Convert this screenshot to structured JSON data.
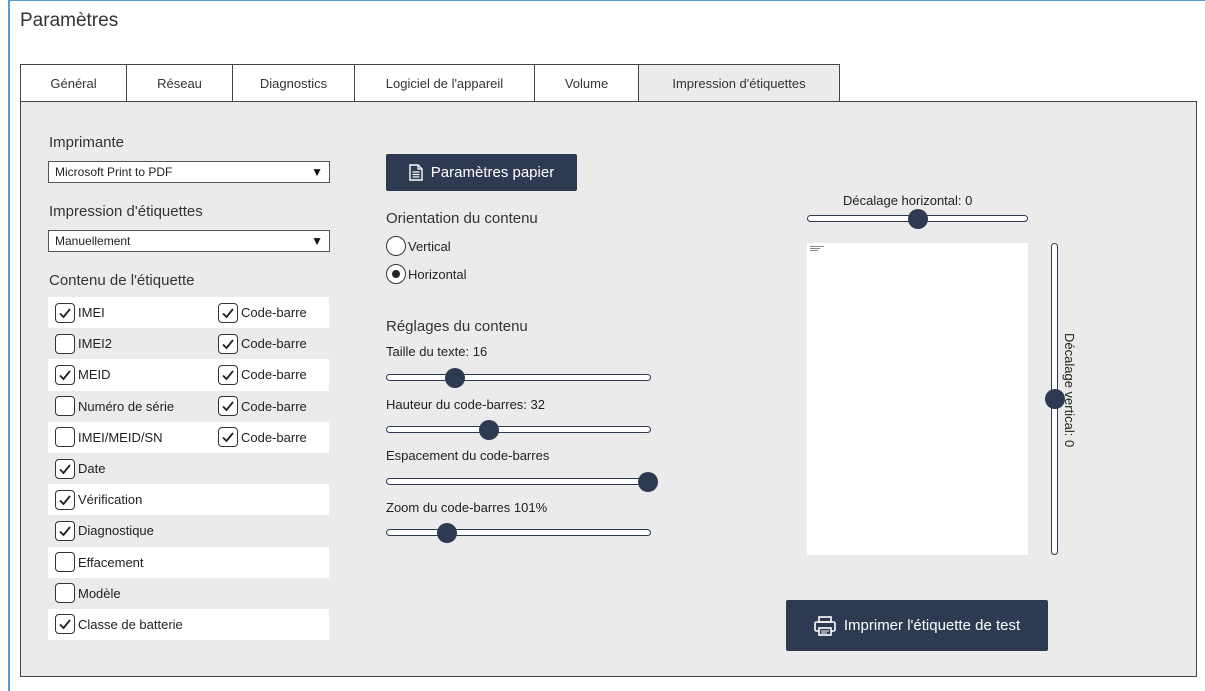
{
  "page_title": "Paramètres",
  "tabs": [
    {
      "label": "Général"
    },
    {
      "label": "Réseau"
    },
    {
      "label": "Diagnostics"
    },
    {
      "label": "Logiciel de l'appareil"
    },
    {
      "label": "Volume"
    },
    {
      "label": "Impression d'étiquettes",
      "active": true
    }
  ],
  "printer": {
    "label": "Imprimante",
    "selected": "Microsoft Print to PDF"
  },
  "label_printing": {
    "label": "Impression d'étiquettes",
    "selected": "Manuellement"
  },
  "label_content": {
    "label": "Contenu de l'étiquette",
    "items": [
      {
        "label": "IMEI",
        "checked": true,
        "barcode_label": "Code-barre",
        "barcode_checked": true
      },
      {
        "label": "IMEI2",
        "checked": false,
        "barcode_label": "Code-barre",
        "barcode_checked": true
      },
      {
        "label": "MEID",
        "checked": true,
        "barcode_label": "Code-barre",
        "barcode_checked": true
      },
      {
        "label": "Numéro de série",
        "checked": false,
        "barcode_label": "Code-barre",
        "barcode_checked": true
      },
      {
        "label": "IMEI/MEID/SN",
        "checked": false,
        "barcode_label": "Code-barre",
        "barcode_checked": true
      },
      {
        "label": "Date",
        "checked": true
      },
      {
        "label": "Vérification",
        "checked": true
      },
      {
        "label": "Diagnostique",
        "checked": true
      },
      {
        "label": "Effacement",
        "checked": false
      },
      {
        "label": "Modèle",
        "checked": false
      },
      {
        "label": "Classe de batterie",
        "checked": true
      }
    ]
  },
  "paper_settings_button": "Paramètres papier",
  "orientation": {
    "label": "Orientation du contenu",
    "options": [
      {
        "label": "Vertical",
        "selected": false
      },
      {
        "label": "Horizontal",
        "selected": true
      }
    ]
  },
  "content_settings": {
    "label": "Réglages du contenu",
    "text_size": {
      "label": "Taille du texte: 16",
      "value": 16,
      "fraction": 0.26
    },
    "barcode_height": {
      "label": "Hauteur du code-barres: 32",
      "value": 32,
      "fraction": 0.39
    },
    "barcode_spacing": {
      "label": "Espacement du code-barres",
      "fraction": 0.99
    },
    "barcode_zoom": {
      "label": "Zoom du code-barres 101%",
      "value": 101,
      "fraction": 0.23
    }
  },
  "horizontal_offset": {
    "label": "Décalage horizontal: 0",
    "value": 0,
    "fraction": 0.5
  },
  "vertical_offset": {
    "label": "Décalage vertical: 0",
    "value": 0,
    "fraction": 0.5
  },
  "print_test_button": "Imprimer l'étiquette de test",
  "colors": {
    "accent": "#2d3a52",
    "panel": "#ebebeb",
    "frame": "#5b9bd5"
  }
}
